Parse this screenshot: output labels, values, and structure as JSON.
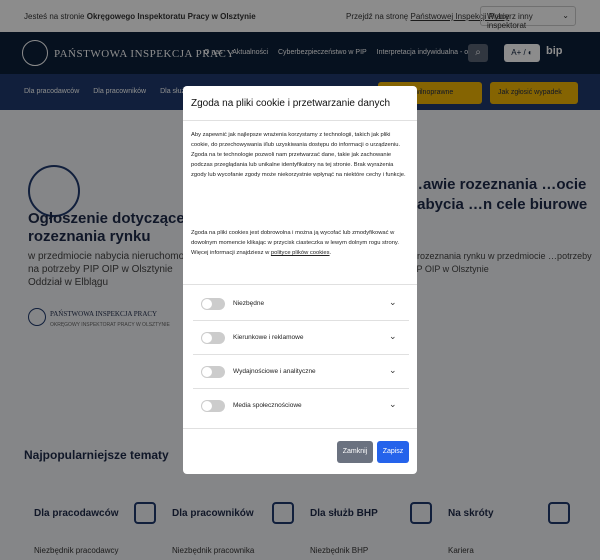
{
  "topbar": {
    "left_prefix": "Jesteś na stronie",
    "left_bold": "Okręgowego Inspektoratu Pracy w Olsztynie",
    "right_prefix": "Przejdź na stronę",
    "right_link": "Państwowej Inspekcji Pracy",
    "select": "Wybierz inny inspektorat"
  },
  "header": {
    "logo_text": "PAŃSTWOWA INSPEKCJA PRACY",
    "nav": [
      "O nas",
      "Aktualności",
      "Cyberbezpieczeństwo w PIP",
      "Interpretacja indywidualna - opłata"
    ],
    "acc": "A+ / ◐",
    "bip": "bip"
  },
  "subnav": {
    "items": [
      "Dla pracodawców",
      "Dla pracowników",
      "Dla służb"
    ],
    "btn1": "…owy cywilnoprawne",
    "btn2": "Jak zgłosić wypadek"
  },
  "card": {
    "title": "Ogłoszenie dotyczące rozeznania rynku",
    "desc": "w przedmiocie nabycia nieruchomości na potrzeby PIP OIP w Olsztynie Oddział w Elblągu",
    "logo_text": "PAŃSTWOWA INSPEKCJA PRACY",
    "logo_sub": "OKRĘGOWY INSPEKTORAT PRACY W OLSZTYNIE"
  },
  "right": {
    "title": "…awie rozeznania …ocie nabycia …n cele biurowe",
    "desc": "…rozeznania rynku w przedmiocie …potrzeby PIP OIP w Olsztynie"
  },
  "popular": {
    "title": "Najpopularniejsze tematy",
    "cats": [
      {
        "label": "Dla pracodawców",
        "link": "Niezbędnik pracodawcy"
      },
      {
        "label": "Dla pracowników",
        "link": "Niezbędnik pracownika"
      },
      {
        "label": "Dla służb BHP",
        "link": "Niezbędnik BHP"
      },
      {
        "label": "Na skróty",
        "link": "Kariera"
      }
    ]
  },
  "modal": {
    "title": "Zgoda na pliki cookie i przetwarzanie danych",
    "p1": "Aby zapewnić jak najlepsze wrażenia korzystamy z technologii, takich jak pliki cookie, do przechowywania i/lub uzyskiwania dostępu do informacji o urządzeniu. Zgoda na te technologie pozwoli nam przetwarzać dane, takie jak zachowanie podczas przeglądania lub unikalne identyfikatory na tej stronie. Brak wyrażenia zgody lub wycofanie zgody może niekorzystnie wpłynąć na niektóre cechy i funkcje.",
    "p2": "Zgoda na pliki cookies jest dobrowolna i można ją wycofać lub zmodyfikować w dowolnym momencie klikając w przycisk ciasteczka w lewym dolnym rogu strony. Więcej informacji znajdziesz w",
    "p2_link": "polityce plików cookies",
    "p2_end": ".",
    "toggles": [
      "Niezbędne",
      "Kierunkowe i reklamowe",
      "Wydajnościowe i analityczne",
      "Media społecznościowe"
    ],
    "close": "Zamknij",
    "save": "Zapisz"
  },
  "colors": {
    "navy": "#0b1f3a",
    "blue": "#1f3a6e",
    "yellow": "#f2b705",
    "btn_gray": "#6b7280",
    "btn_blue": "#2563eb"
  }
}
